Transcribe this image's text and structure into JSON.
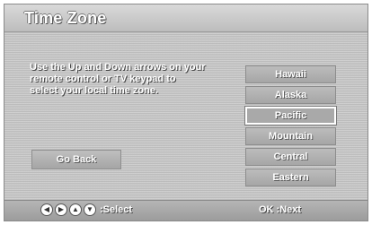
{
  "screen": {
    "title": "Time Zone",
    "instructions": "Use the Up and Down arrows on your\nremote control or TV keypad to\nselect your local time zone."
  },
  "go_back": {
    "label": "Go Back"
  },
  "time_zones": {
    "items": [
      {
        "label": "Hawaii"
      },
      {
        "label": "Alaska"
      },
      {
        "label": "Pacific"
      },
      {
        "label": "Mountain"
      },
      {
        "label": "Central"
      },
      {
        "label": "Eastern"
      }
    ],
    "selected": "Pacific"
  },
  "footer": {
    "nav_icons": [
      "left-arrow-icon",
      "right-arrow-icon",
      "up-arrow-icon",
      "down-arrow-icon"
    ],
    "select_label": ":Select",
    "next_label": "OK :Next"
  }
}
